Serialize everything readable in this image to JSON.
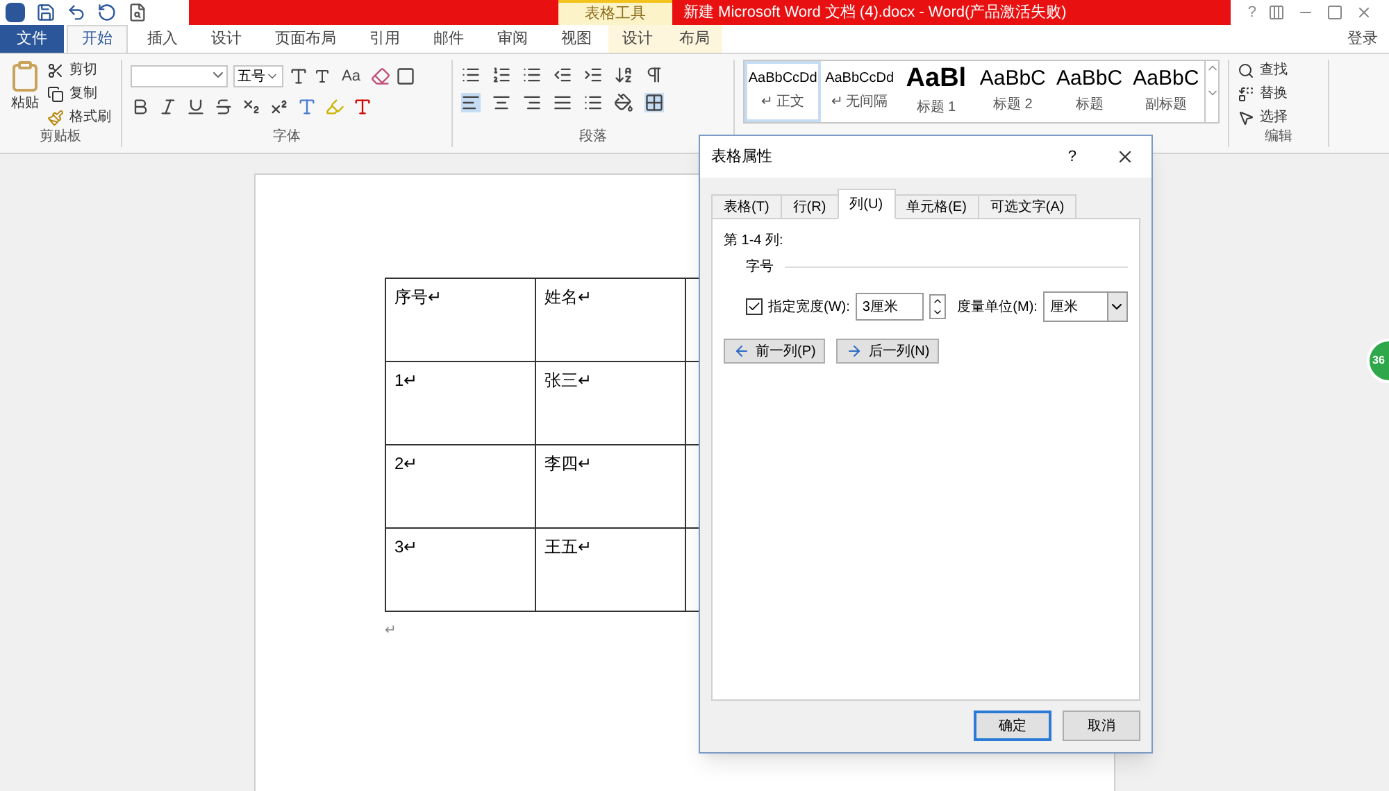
{
  "title_bar": {
    "context_group": "表格工具",
    "title": "新建 Microsoft Word 文档 (4).docx -  Word(产品激活失败)",
    "help": "?"
  },
  "tabs": [
    {
      "label": "文件",
      "kind": "file",
      "selected": false
    },
    {
      "label": "开始",
      "kind": "normal",
      "selected": true
    },
    {
      "label": "插入",
      "kind": "normal",
      "selected": false
    },
    {
      "label": "设计",
      "kind": "normal",
      "selected": false
    },
    {
      "label": "页面布局",
      "kind": "normal",
      "selected": false
    },
    {
      "label": "引用",
      "kind": "normal",
      "selected": false
    },
    {
      "label": "邮件",
      "kind": "normal",
      "selected": false
    },
    {
      "label": "审阅",
      "kind": "normal",
      "selected": false
    },
    {
      "label": "视图",
      "kind": "normal",
      "selected": false
    },
    {
      "label": "设计",
      "kind": "context",
      "selected": false
    },
    {
      "label": "布局",
      "kind": "context",
      "selected": false
    }
  ],
  "sign_in": "登录",
  "clipboard": {
    "paste": "粘贴",
    "items": [
      "剪切",
      "复制",
      "格式刷"
    ],
    "label": "剪贴板"
  },
  "font": {
    "size": "五号",
    "case_button": "Aa",
    "label": "字体"
  },
  "paragraph": {
    "label": "段落"
  },
  "styles": [
    {
      "preview": "AaBbCcDd",
      "name": "↵ 正文",
      "kind": "small",
      "selected": true
    },
    {
      "preview": "AaBbCcDd",
      "name": "↵ 无间隔",
      "kind": "small",
      "selected": false
    },
    {
      "preview": "AaBl",
      "name": "标题 1",
      "kind": "heading",
      "selected": false
    },
    {
      "preview": "AaBbC",
      "name": "标题 2",
      "kind": "large",
      "selected": false
    },
    {
      "preview": "AaBbC",
      "name": "标题",
      "kind": "large",
      "selected": false
    },
    {
      "preview": "AaBbC",
      "name": "副标题",
      "kind": "large",
      "selected": false
    }
  ],
  "editing": {
    "items": [
      "查找",
      "替换",
      "选择"
    ],
    "label": "编辑"
  },
  "document": {
    "rows": [
      [
        "序号↵",
        "姓名↵"
      ],
      [
        "1↵",
        "张三↵"
      ],
      [
        "2↵",
        "李四↵"
      ],
      [
        "3↵",
        "王五↵"
      ]
    ],
    "end_mark": "↵"
  },
  "dialog": {
    "title": "表格属性",
    "help": "?",
    "tabs": [
      {
        "label": "表格(T)",
        "selected": false
      },
      {
        "label": "行(R)",
        "selected": false
      },
      {
        "label": "列(U)",
        "selected": true
      },
      {
        "label": "单元格(E)",
        "selected": false
      },
      {
        "label": "可选文字(A)",
        "selected": false
      }
    ],
    "section": "第 1-4 列:",
    "group": "字号",
    "width_check": {
      "label": "指定宽度(W):",
      "checked": true
    },
    "width_value": "3厘米",
    "unit_label": "度量单位(M):",
    "unit_value": "厘米",
    "prev": "前一列(P)",
    "next": "后一列(N)",
    "ok": "确定",
    "cancel": "取消"
  },
  "float_badge": "36"
}
